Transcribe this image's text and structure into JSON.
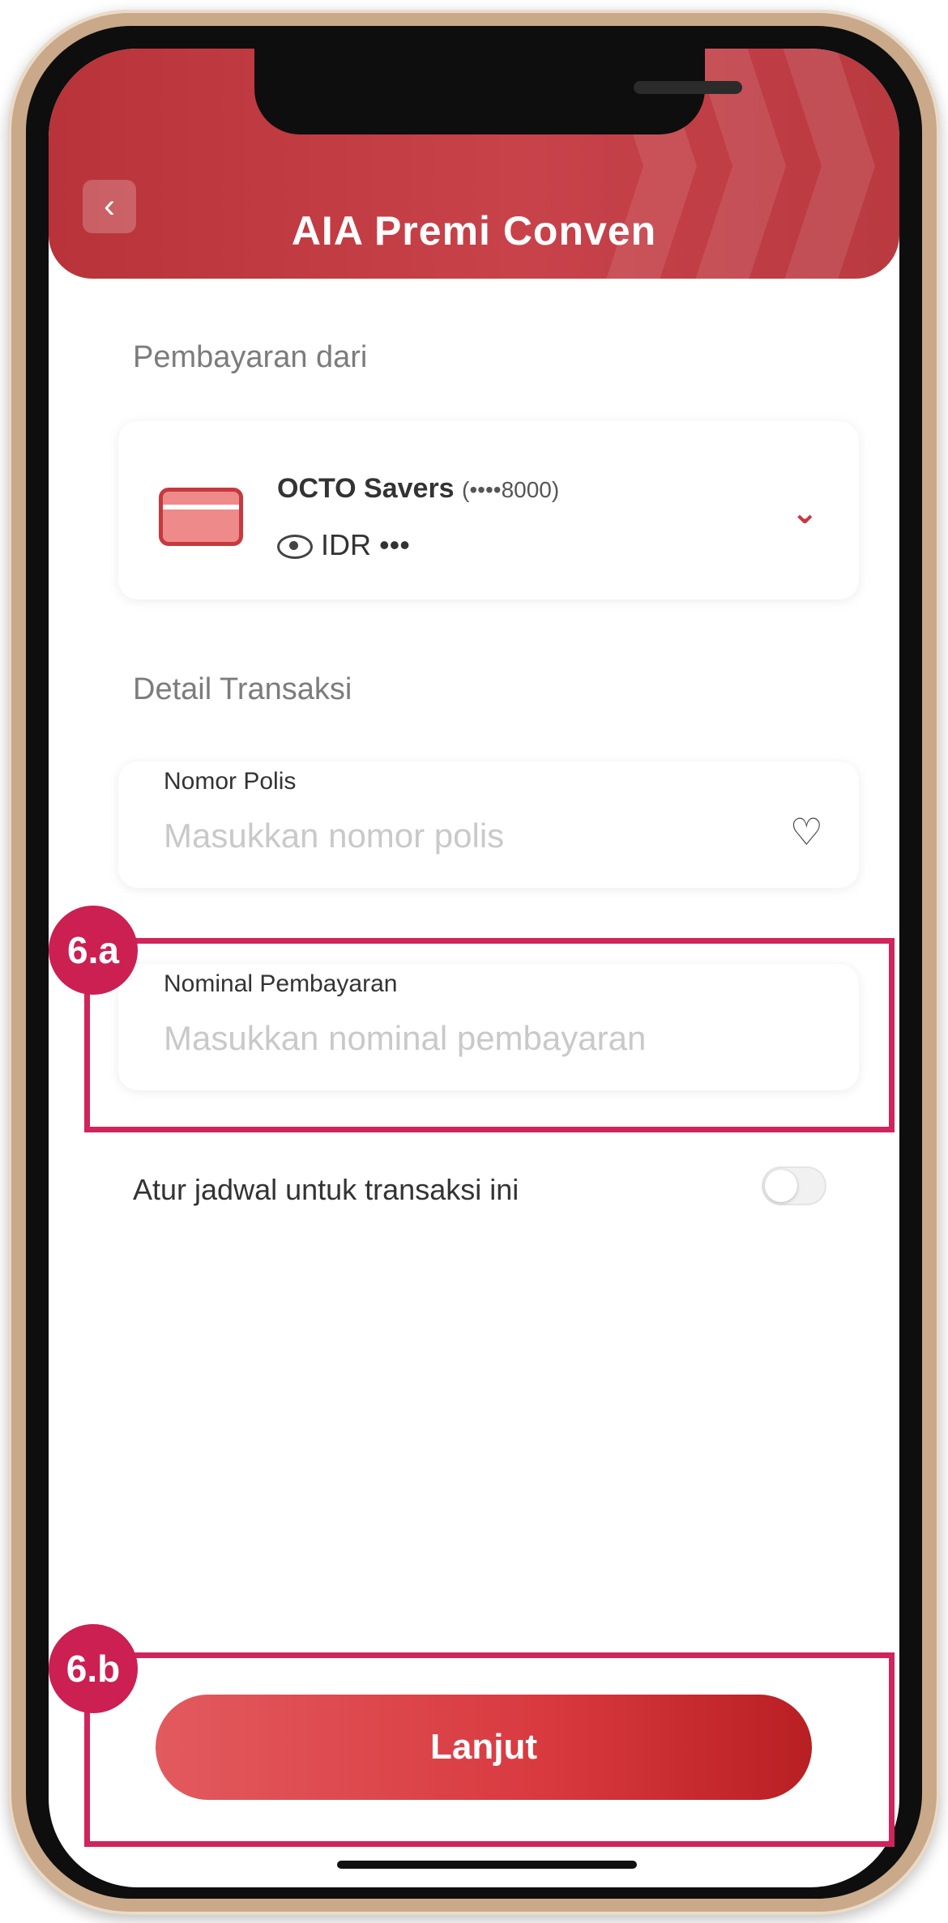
{
  "header": {
    "title": "AIA Premi Conven",
    "back_icon": "chevron-left-icon"
  },
  "payment_source": {
    "section_label": "Pembayaran dari",
    "account_name": "OCTO Savers",
    "account_number": "(••••8000)",
    "balance": "IDR •••",
    "icons": [
      "card-icon",
      "eye-icon",
      "chevron-down-icon"
    ]
  },
  "transaction": {
    "section_label": "Detail Transaksi",
    "policy_number": {
      "label": "Nomor Polis",
      "placeholder": "Masukkan nomor polis",
      "icon": "heart-icon"
    },
    "payment_amount": {
      "label": "Nominal Pembayaran",
      "placeholder": "Masukkan nominal pembayaran"
    }
  },
  "schedule": {
    "label": "Atur jadwal untuk transaksi ini",
    "enabled": false
  },
  "actions": {
    "continue_label": "Lanjut"
  },
  "annotations": [
    {
      "label": "6.a"
    },
    {
      "label": "6.b"
    }
  ],
  "colors": {
    "header": "#c8424a",
    "accent": "#c7393e",
    "annotation": "#d0245a"
  }
}
